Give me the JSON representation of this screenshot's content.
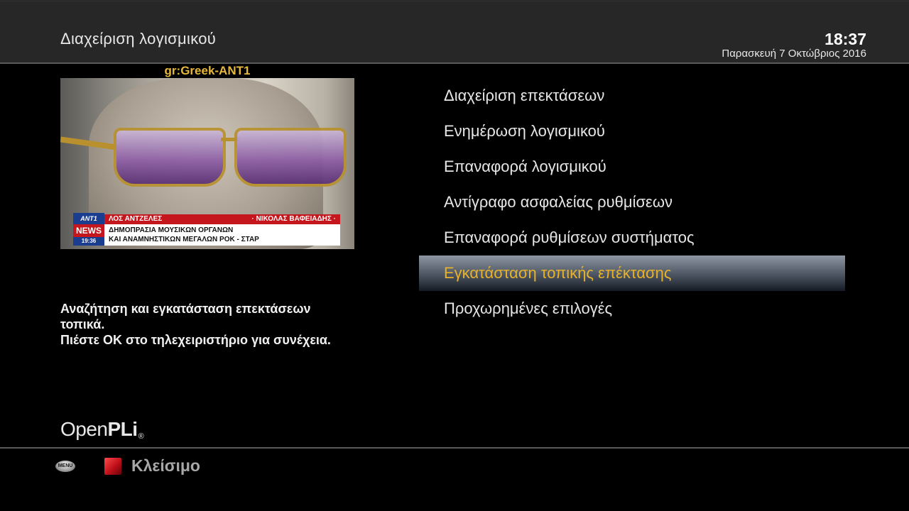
{
  "header": {
    "title": "Διαχείριση λογισμικού",
    "time": "18:37",
    "date": "Παρασκευή  7 Οκτώβριος 2016"
  },
  "preview": {
    "channel": "gr:Greek-ANT1",
    "ticker_left": "ΛΟΣ ΑΝΤΖΕΛΕΣ",
    "ticker_right": "· ΝΙΚΟΛΑΣ ΒΑΦΕΙΑΔΗΣ ·",
    "ticker_line1": "ΔΗΜΟΠΡΑΣΙΑ ΜΟΥΣΙΚΩΝ ΟΡΓΑΝΩΝ",
    "ticker_line2": "ΚΑΙ ΑΝΑΜΝΗΣΤΙΚΩΝ ΜΕΓΑΛΩΝ ΡΟΚ - ΣΤΑΡ",
    "logo_ant": "ΑΝΤ1",
    "logo_news": "NEWS",
    "logo_time": "19:36"
  },
  "description": {
    "line1": "Αναζήτηση και εγκατάσταση επεκτάσεων",
    "line2": "τοπικά.",
    "line3": "Πιέστε OK στο τηλεχειριστήριο για συνέχεια."
  },
  "brand": {
    "open": "Open",
    "pli": "PLi",
    "reg": "®"
  },
  "menu": {
    "selected_index": 5,
    "items": [
      "Διαχείριση επεκτάσεων",
      "Ενημέρωση λογισμικού",
      "Επαναφορά λογισμικού",
      "Αντίγραφο ασφαλείας ρυθμίσεων",
      "Επαναφορά ρυθμίσεων συστήματος",
      "Εγκατάσταση τοπικής επέκτασης",
      "Προχωρημένες επιλογές"
    ]
  },
  "footer": {
    "menu_key_label": "MENU",
    "red_label": "Κλείσιμο"
  },
  "colors": {
    "background": "#000000",
    "header": "#272727",
    "selected_text": "#e8b22a",
    "channel_text": "#e8b83a",
    "red_button": "#c0101a"
  }
}
